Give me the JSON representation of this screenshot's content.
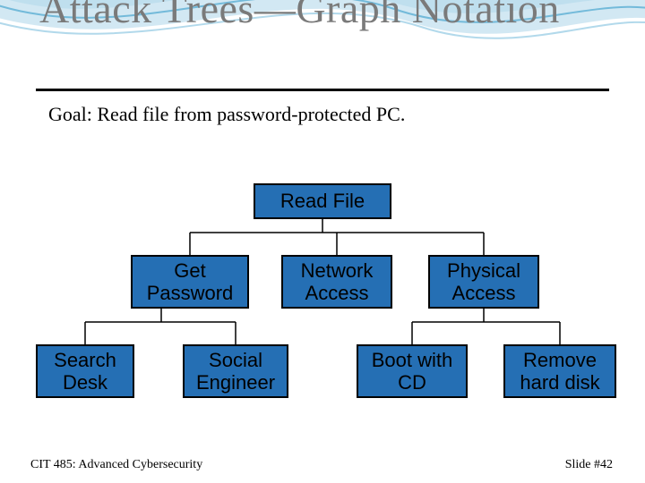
{
  "title": "Attack Trees—Graph Notation",
  "goal": "Goal: Read file from password-protected PC.",
  "nodes": {
    "root": "Read File",
    "l2": {
      "a": "Get\nPassword",
      "b": "Network\nAccess",
      "c": "Physical\nAccess"
    },
    "l3": {
      "a": "Search\nDesk",
      "b": "Social\nEngineer",
      "c": "Boot with\nCD",
      "d": "Remove\nhard disk"
    }
  },
  "footer": {
    "left": "CIT 485: Advanced Cybersecurity",
    "right": "Slide #42"
  },
  "colors": {
    "node_fill": "#256fb4",
    "title_color": "#7a7a7a"
  },
  "chart_data": {
    "type": "tree",
    "title": "Attack Trees—Graph Notation",
    "goal": "Read file from password-protected PC.",
    "root": {
      "label": "Read File",
      "children": [
        {
          "label": "Get Password",
          "children": [
            {
              "label": "Search Desk"
            },
            {
              "label": "Social Engineer"
            }
          ]
        },
        {
          "label": "Network Access"
        },
        {
          "label": "Physical Access",
          "children": [
            {
              "label": "Boot with CD"
            },
            {
              "label": "Remove hard disk"
            }
          ]
        }
      ]
    }
  }
}
